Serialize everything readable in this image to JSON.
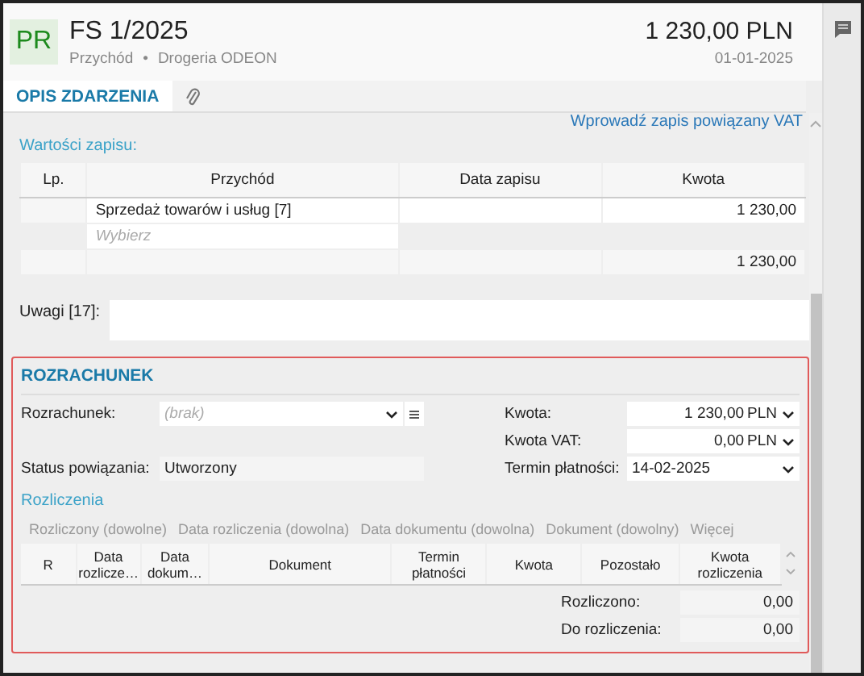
{
  "header": {
    "badge": "PR",
    "title": "FS 1/2025",
    "type": "Przychód",
    "separator": "•",
    "contractor": "Drogeria ODEON",
    "amount": "1 230,00 PLN",
    "date": "01-01-2025"
  },
  "tabs": [
    {
      "kind": "text",
      "label": "OPIS ZDARZENIA",
      "selected": true
    },
    {
      "kind": "attachment",
      "selected": false
    }
  ],
  "link": "Wprowadź zapis powiązany VAT",
  "values": {
    "title": "Wartości zapisu:",
    "columns": [
      "Lp.",
      "Przychód",
      "Data zapisu",
      "Kwota"
    ],
    "rows": [
      {
        "lp": "",
        "name": "Sprzedaż towarów i usług  [7]",
        "date": "",
        "amount": "1 230,00"
      }
    ],
    "picker_placeholder": "Wybierz",
    "total": "1 230,00"
  },
  "notes": {
    "label": "Uwagi [17]:"
  },
  "settlement": {
    "title": "ROZRACHUNEK",
    "highlighted": true,
    "left_fields": [
      {
        "kind": "select",
        "label": "Rozrachunek:",
        "placeholder": "(brak)"
      },
      {
        "kind": "readonly",
        "label": "Status powiązania:",
        "value": "Utworzony"
      }
    ],
    "right_fields": [
      {
        "kind": "amount",
        "label": "Kwota:",
        "value": "1 230,00",
        "currency": "PLN"
      },
      {
        "kind": "amount",
        "label": "Kwota VAT:",
        "value": "0,00",
        "currency": "PLN"
      },
      {
        "kind": "date",
        "label": "Termin płatności:",
        "value": "14-02-2025"
      }
    ],
    "subtitle": "Rozliczenia",
    "filters": [
      "Rozliczony (dowolne)",
      "Data rozliczenia (dowolna)",
      "Data dokumentu (dowolna)",
      "Dokument (dowolny)",
      "Więcej"
    ],
    "columns": [
      "R",
      "Data rozlicze…",
      "Data dokum…",
      "Dokument",
      "Termin płatności",
      "Kwota",
      "Pozostało",
      "Kwota rozliczenia"
    ],
    "summary": [
      {
        "label": "Rozliczono:",
        "value": "0,00"
      },
      {
        "label": "Do rozliczenia:",
        "value": "0,00"
      }
    ]
  }
}
